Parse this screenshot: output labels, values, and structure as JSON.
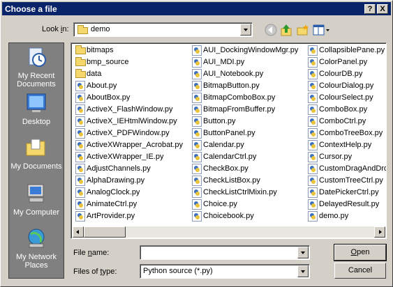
{
  "window": {
    "title": "Choose a file",
    "help_label": "?",
    "close_label": "X"
  },
  "toolbar": {
    "look_in_label": "Look in:",
    "look_in_value": "demo"
  },
  "places": [
    {
      "label": "My Recent Documents",
      "icon": "recent-documents-icon"
    },
    {
      "label": "Desktop",
      "icon": "desktop-icon"
    },
    {
      "label": "My Documents",
      "icon": "my-documents-icon"
    },
    {
      "label": "My Computer",
      "icon": "my-computer-icon"
    },
    {
      "label": "My Network Places",
      "icon": "network-places-icon"
    }
  ],
  "files": {
    "col1": [
      {
        "name": "bitmaps",
        "type": "folder"
      },
      {
        "name": "bmp_source",
        "type": "folder"
      },
      {
        "name": "data",
        "type": "folder"
      },
      {
        "name": "About.py",
        "type": "py"
      },
      {
        "name": "AboutBox.py",
        "type": "py"
      },
      {
        "name": "ActiveX_FlashWindow.py",
        "type": "py"
      },
      {
        "name": "ActiveX_IEHtmlWindow.py",
        "type": "py"
      },
      {
        "name": "ActiveX_PDFWindow.py",
        "type": "py"
      },
      {
        "name": "ActiveXWrapper_Acrobat.py",
        "type": "py"
      },
      {
        "name": "ActiveXWrapper_IE.py",
        "type": "py"
      },
      {
        "name": "AdjustChannels.py",
        "type": "py"
      },
      {
        "name": "AlphaDrawing.py",
        "type": "py"
      },
      {
        "name": "AnalogClock.py",
        "type": "py"
      },
      {
        "name": "AnimateCtrl.py",
        "type": "py"
      },
      {
        "name": "ArtProvider.py",
        "type": "py"
      }
    ],
    "col2": [
      {
        "name": "AUI_DockingWindowMgr.py",
        "type": "py"
      },
      {
        "name": "AUI_MDI.py",
        "type": "py"
      },
      {
        "name": "AUI_Notebook.py",
        "type": "py"
      },
      {
        "name": "BitmapButton.py",
        "type": "py"
      },
      {
        "name": "BitmapComboBox.py",
        "type": "py"
      },
      {
        "name": "BitmapFromBuffer.py",
        "type": "py"
      },
      {
        "name": "Button.py",
        "type": "py"
      },
      {
        "name": "ButtonPanel.py",
        "type": "py"
      },
      {
        "name": "Calendar.py",
        "type": "py"
      },
      {
        "name": "CalendarCtrl.py",
        "type": "py"
      },
      {
        "name": "CheckBox.py",
        "type": "py"
      },
      {
        "name": "CheckListBox.py",
        "type": "py"
      },
      {
        "name": "CheckListCtrlMixin.py",
        "type": "py"
      },
      {
        "name": "Choice.py",
        "type": "py"
      },
      {
        "name": "Choicebook.py",
        "type": "py"
      }
    ],
    "col3": [
      {
        "name": "CollapsiblePane.py",
        "type": "py"
      },
      {
        "name": "ColorPanel.py",
        "type": "py"
      },
      {
        "name": "ColourDB.py",
        "type": "py"
      },
      {
        "name": "ColourDialog.py",
        "type": "py"
      },
      {
        "name": "ColourSelect.py",
        "type": "py"
      },
      {
        "name": "ComboBox.py",
        "type": "py"
      },
      {
        "name": "ComboCtrl.py",
        "type": "py"
      },
      {
        "name": "ComboTreeBox.py",
        "type": "py"
      },
      {
        "name": "ContextHelp.py",
        "type": "py"
      },
      {
        "name": "Cursor.py",
        "type": "py"
      },
      {
        "name": "CustomDragAndDrop.py",
        "type": "py"
      },
      {
        "name": "CustomTreeCtrl.py",
        "type": "py"
      },
      {
        "name": "DatePickerCtrl.py",
        "type": "py"
      },
      {
        "name": "DelayedResult.py",
        "type": "py"
      },
      {
        "name": "demo.py",
        "type": "py"
      }
    ]
  },
  "form": {
    "file_name_label": "File name:",
    "file_name_value": "",
    "file_type_label": "Files of type:",
    "file_type_value": "Python source (*.py)"
  },
  "buttons": {
    "open": "Open",
    "cancel": "Cancel"
  }
}
